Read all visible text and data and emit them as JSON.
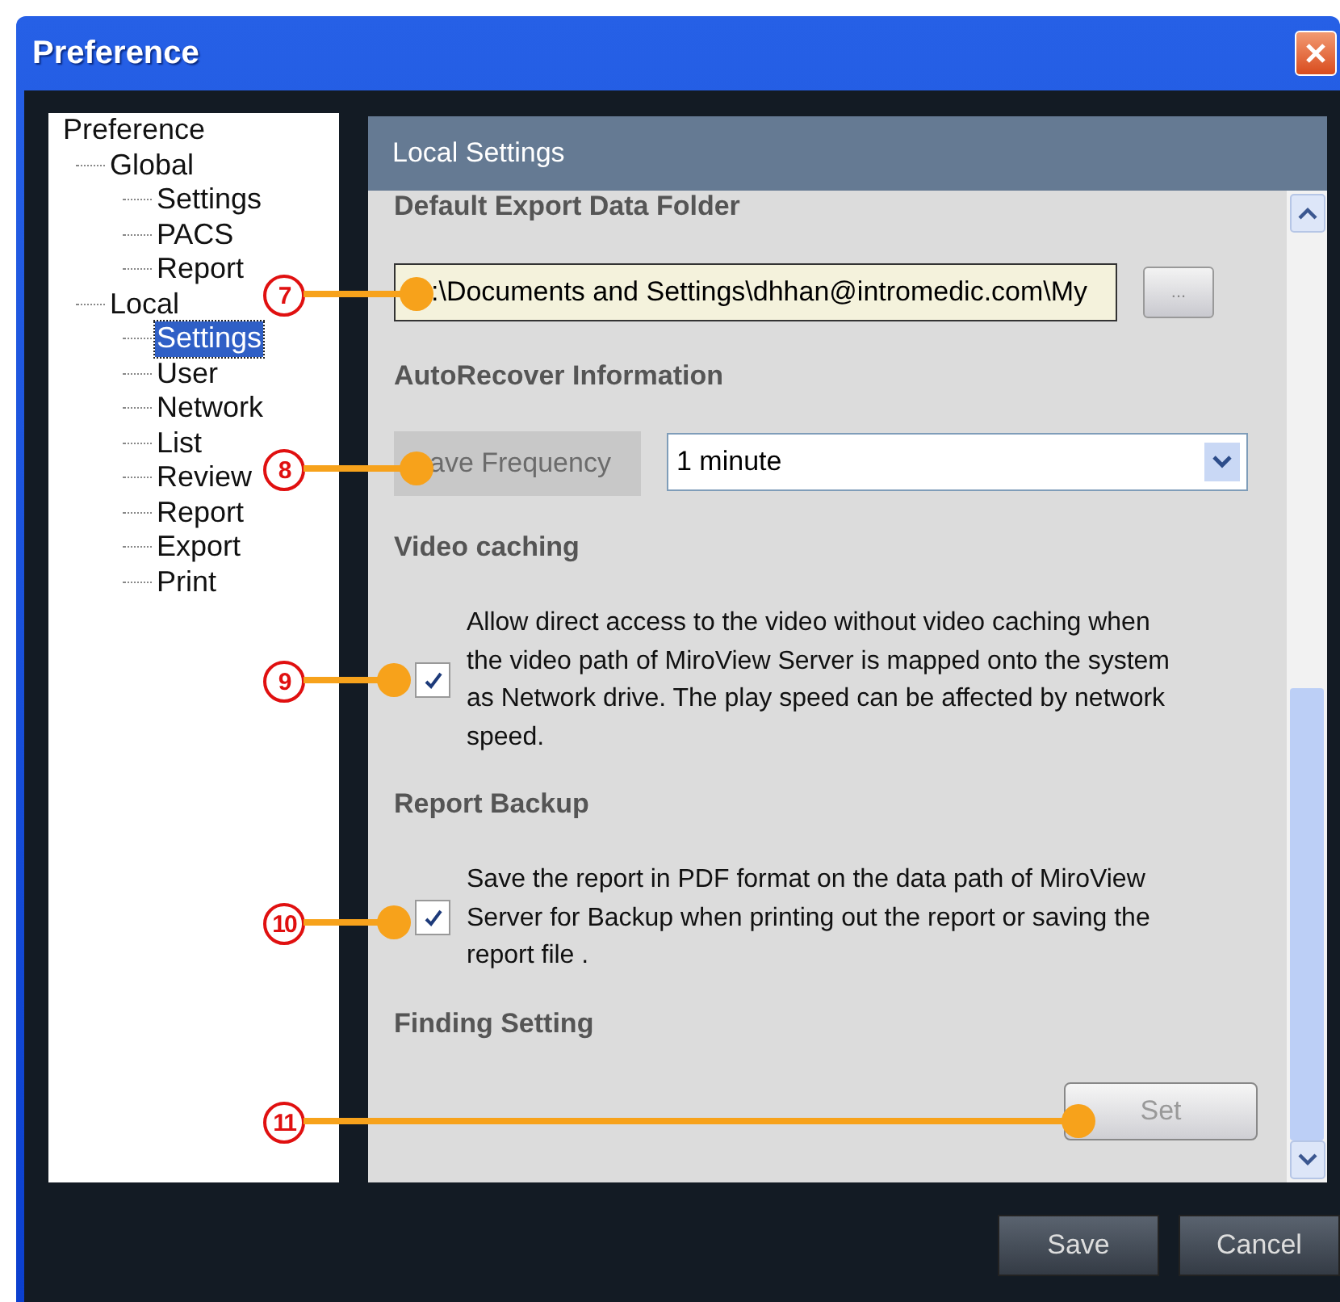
{
  "window": {
    "title": "Preference"
  },
  "tree": [
    {
      "label": "Preference",
      "selected": false,
      "children": [
        {
          "label": "Global",
          "selected": false,
          "children": [
            {
              "label": "Settings",
              "selected": false
            },
            {
              "label": "PACS",
              "selected": false
            },
            {
              "label": "Report",
              "selected": false
            }
          ]
        },
        {
          "label": "Local",
          "selected": false,
          "children": [
            {
              "label": "Settings",
              "selected": true
            },
            {
              "label": "User",
              "selected": false
            },
            {
              "label": "Network",
              "selected": false
            },
            {
              "label": "List",
              "selected": false
            },
            {
              "label": "Review",
              "selected": false
            },
            {
              "label": "Report",
              "selected": false
            },
            {
              "label": "Export",
              "selected": false
            },
            {
              "label": "Print",
              "selected": false
            }
          ]
        }
      ]
    }
  ],
  "panel": {
    "title": "Local Settings",
    "sections": [
      {
        "kind": "folder",
        "heading": "Default Export Data Folder",
        "value": ":\\Documents and Settings\\dhhan@intromedic.com\\My",
        "button": "..."
      },
      {
        "kind": "dropdown",
        "heading": "AutoRecover Information",
        "label": "ave Frequency",
        "value": "1 minute"
      },
      {
        "kind": "checkbox",
        "heading": "Video caching",
        "checked": true,
        "text": "Allow direct access to the video without video caching when the video path of MiroView Server is mapped onto the system as Network drive. The play speed can be affected by network speed."
      },
      {
        "kind": "checkbox",
        "heading": "Report Backup",
        "checked": true,
        "text": "Save the report in PDF format on the data path of MiroView Server for Backup when printing out the report or saving the report file ."
      },
      {
        "kind": "button",
        "heading": "Finding Setting",
        "button": "Set",
        "disabled": true
      }
    ]
  },
  "buttons": [
    "Save",
    "Cancel"
  ],
  "callouts": [
    "7",
    "8",
    "9",
    "10",
    "11"
  ]
}
